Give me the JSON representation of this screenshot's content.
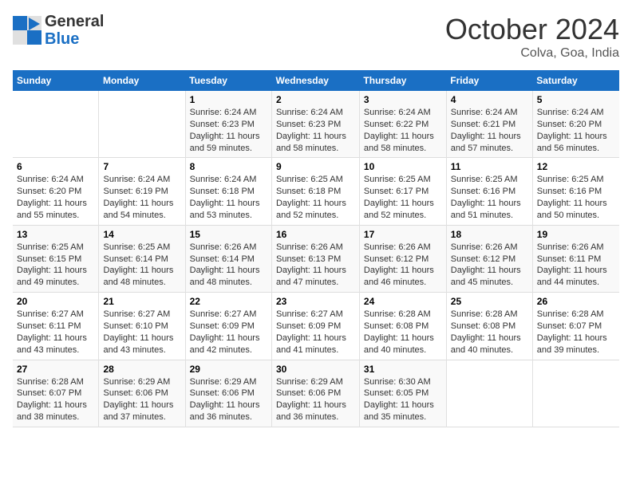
{
  "header": {
    "logo_line1": "General",
    "logo_line2": "Blue",
    "month": "October 2024",
    "location": "Colva, Goa, India"
  },
  "weekdays": [
    "Sunday",
    "Monday",
    "Tuesday",
    "Wednesday",
    "Thursday",
    "Friday",
    "Saturday"
  ],
  "weeks": [
    [
      {
        "day": "",
        "info": ""
      },
      {
        "day": "",
        "info": ""
      },
      {
        "day": "1",
        "info": "Sunrise: 6:24 AM\nSunset: 6:23 PM\nDaylight: 11 hours and 59 minutes."
      },
      {
        "day": "2",
        "info": "Sunrise: 6:24 AM\nSunset: 6:23 PM\nDaylight: 11 hours and 58 minutes."
      },
      {
        "day": "3",
        "info": "Sunrise: 6:24 AM\nSunset: 6:22 PM\nDaylight: 11 hours and 58 minutes."
      },
      {
        "day": "4",
        "info": "Sunrise: 6:24 AM\nSunset: 6:21 PM\nDaylight: 11 hours and 57 minutes."
      },
      {
        "day": "5",
        "info": "Sunrise: 6:24 AM\nSunset: 6:20 PM\nDaylight: 11 hours and 56 minutes."
      }
    ],
    [
      {
        "day": "6",
        "info": "Sunrise: 6:24 AM\nSunset: 6:20 PM\nDaylight: 11 hours and 55 minutes."
      },
      {
        "day": "7",
        "info": "Sunrise: 6:24 AM\nSunset: 6:19 PM\nDaylight: 11 hours and 54 minutes."
      },
      {
        "day": "8",
        "info": "Sunrise: 6:24 AM\nSunset: 6:18 PM\nDaylight: 11 hours and 53 minutes."
      },
      {
        "day": "9",
        "info": "Sunrise: 6:25 AM\nSunset: 6:18 PM\nDaylight: 11 hours and 52 minutes."
      },
      {
        "day": "10",
        "info": "Sunrise: 6:25 AM\nSunset: 6:17 PM\nDaylight: 11 hours and 52 minutes."
      },
      {
        "day": "11",
        "info": "Sunrise: 6:25 AM\nSunset: 6:16 PM\nDaylight: 11 hours and 51 minutes."
      },
      {
        "day": "12",
        "info": "Sunrise: 6:25 AM\nSunset: 6:16 PM\nDaylight: 11 hours and 50 minutes."
      }
    ],
    [
      {
        "day": "13",
        "info": "Sunrise: 6:25 AM\nSunset: 6:15 PM\nDaylight: 11 hours and 49 minutes."
      },
      {
        "day": "14",
        "info": "Sunrise: 6:25 AM\nSunset: 6:14 PM\nDaylight: 11 hours and 48 minutes."
      },
      {
        "day": "15",
        "info": "Sunrise: 6:26 AM\nSunset: 6:14 PM\nDaylight: 11 hours and 48 minutes."
      },
      {
        "day": "16",
        "info": "Sunrise: 6:26 AM\nSunset: 6:13 PM\nDaylight: 11 hours and 47 minutes."
      },
      {
        "day": "17",
        "info": "Sunrise: 6:26 AM\nSunset: 6:12 PM\nDaylight: 11 hours and 46 minutes."
      },
      {
        "day": "18",
        "info": "Sunrise: 6:26 AM\nSunset: 6:12 PM\nDaylight: 11 hours and 45 minutes."
      },
      {
        "day": "19",
        "info": "Sunrise: 6:26 AM\nSunset: 6:11 PM\nDaylight: 11 hours and 44 minutes."
      }
    ],
    [
      {
        "day": "20",
        "info": "Sunrise: 6:27 AM\nSunset: 6:11 PM\nDaylight: 11 hours and 43 minutes."
      },
      {
        "day": "21",
        "info": "Sunrise: 6:27 AM\nSunset: 6:10 PM\nDaylight: 11 hours and 43 minutes."
      },
      {
        "day": "22",
        "info": "Sunrise: 6:27 AM\nSunset: 6:09 PM\nDaylight: 11 hours and 42 minutes."
      },
      {
        "day": "23",
        "info": "Sunrise: 6:27 AM\nSunset: 6:09 PM\nDaylight: 11 hours and 41 minutes."
      },
      {
        "day": "24",
        "info": "Sunrise: 6:28 AM\nSunset: 6:08 PM\nDaylight: 11 hours and 40 minutes."
      },
      {
        "day": "25",
        "info": "Sunrise: 6:28 AM\nSunset: 6:08 PM\nDaylight: 11 hours and 40 minutes."
      },
      {
        "day": "26",
        "info": "Sunrise: 6:28 AM\nSunset: 6:07 PM\nDaylight: 11 hours and 39 minutes."
      }
    ],
    [
      {
        "day": "27",
        "info": "Sunrise: 6:28 AM\nSunset: 6:07 PM\nDaylight: 11 hours and 38 minutes."
      },
      {
        "day": "28",
        "info": "Sunrise: 6:29 AM\nSunset: 6:06 PM\nDaylight: 11 hours and 37 minutes."
      },
      {
        "day": "29",
        "info": "Sunrise: 6:29 AM\nSunset: 6:06 PM\nDaylight: 11 hours and 36 minutes."
      },
      {
        "day": "30",
        "info": "Sunrise: 6:29 AM\nSunset: 6:06 PM\nDaylight: 11 hours and 36 minutes."
      },
      {
        "day": "31",
        "info": "Sunrise: 6:30 AM\nSunset: 6:05 PM\nDaylight: 11 hours and 35 minutes."
      },
      {
        "day": "",
        "info": ""
      },
      {
        "day": "",
        "info": ""
      }
    ]
  ]
}
